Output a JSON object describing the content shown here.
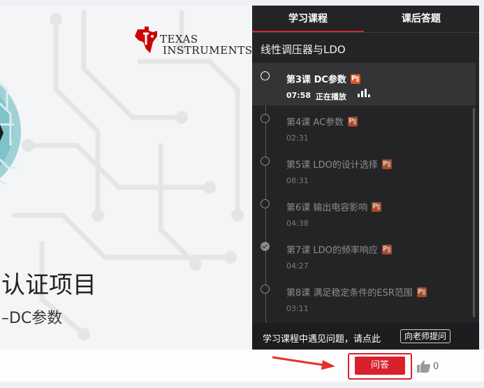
{
  "slide": {
    "logo_line1": "TEXAS",
    "logo_line2": "INSTRUMENTS",
    "title_fragment": "认证项目",
    "subtitle_fragment": "–DC参数"
  },
  "sidebar": {
    "tabs": [
      {
        "label": "学习课程",
        "active": true
      },
      {
        "label": "课后答题",
        "active": false
      }
    ],
    "course_title": "线性调压器与LDO",
    "lessons": [
      {
        "name": "第3课 DC参数",
        "time": "07:58",
        "status": "正在播放",
        "active": true,
        "completed": false,
        "icon": "ppt-icon"
      },
      {
        "name": "第4课 AC参数",
        "time": "02:31",
        "active": false,
        "completed": false,
        "icon": "ppt-icon"
      },
      {
        "name": "第5课 LDO的设计选择",
        "time": "08:31",
        "active": false,
        "completed": false,
        "icon": "ppt-icon"
      },
      {
        "name": "第6课 输出电容影响",
        "time": "04:38",
        "active": false,
        "completed": false,
        "icon": "ppt-icon"
      },
      {
        "name": "第7课 LDO的频率响应",
        "time": "04:27",
        "active": false,
        "completed": true,
        "icon": "ppt-icon"
      },
      {
        "name": "第8课 满足稳定条件的ESR范围",
        "time": "03:11",
        "active": false,
        "completed": false,
        "icon": "ppt-icon"
      }
    ],
    "help_text": "学习课程中遇见问题，请点此",
    "ask_teacher_label": "向老师提问"
  },
  "bottom": {
    "qa_button_label": "问答",
    "like_count": "0"
  },
  "colors": {
    "accent_red": "#d8212b",
    "sidebar_bg": "#232425",
    "ti_red": "#cc0000"
  }
}
